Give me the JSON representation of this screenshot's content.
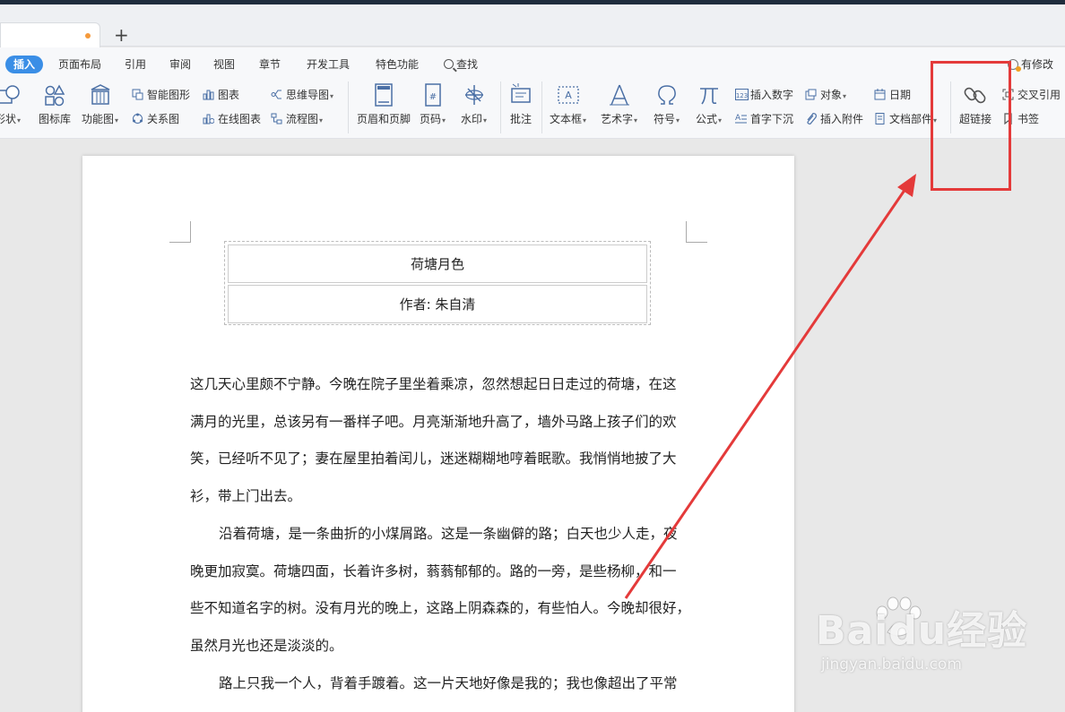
{
  "tabs": {
    "new_tab_symbol": "+"
  },
  "menu": {
    "tabs": [
      "插入",
      "页面布局",
      "引用",
      "审阅",
      "视图",
      "章节",
      "开发工具",
      "特色功能",
      "查找"
    ],
    "active": "插入",
    "revision_label": "有修改"
  },
  "toolbar": {
    "shape_label": "形状",
    "icon_lib_label": "图标库",
    "function_chart_label": "功能图",
    "smart_shape_label": "智能图形",
    "chart_label": "图表",
    "mindmap_label": "思维导图",
    "relation_label": "关系图",
    "online_chart_label": "在线图表",
    "flowchart_label": "流程图",
    "header_footer_label": "页眉和页脚",
    "page_number_label": "页码",
    "watermark_label": "水印",
    "comment_label": "批注",
    "textbox_label": "文本框",
    "wordart_label": "艺术字",
    "symbol_label": "符号",
    "formula_label": "公式",
    "insert_number_label": "插入数字",
    "object_label": "对象",
    "date_label": "日期",
    "drop_cap_label": "首字下沉",
    "attachment_label": "插入附件",
    "doc_parts_label": "文档部件",
    "hyperlink_label": "超链接",
    "cross_ref_label": "交叉引用",
    "bookmark_label": "书签"
  },
  "document": {
    "title": "荷塘月色",
    "author": "作者: 朱自清",
    "lines": [
      "这几天心里颇不宁静。今晚在院子里坐着乘凉，忽然想起日日走过的荷塘，在这",
      "满月的光里，总该另有一番样子吧。月亮渐渐地升高了，墙外马路上孩子们的欢",
      "笑，已经听不见了；妻在屋里拍着闰儿，迷迷糊糊地哼着眠歌。我悄悄地披了大",
      "衫，带上门出去。",
      "沿着荷塘，是一条曲折的小煤屑路。这是一条幽僻的路；白天也少人走，夜",
      "晚更加寂寞。荷塘四面，长着许多树，蓊蓊郁郁的。路的一旁，是些杨柳，和一",
      "些不知道名字的树。没有月光的晚上，这路上阴森森的，有些怕人。今晚却很好，",
      "虽然月光也还是淡淡的。",
      "路上只我一个人，背着手踱着。这一片天地好像是我的；我也像超出了平常"
    ]
  },
  "watermark": {
    "logo": "Baidu经验",
    "url": "jingyan.baidu.com"
  },
  "colors": {
    "accent": "#3a8ee6",
    "annotation_red": "#e43a3a"
  }
}
